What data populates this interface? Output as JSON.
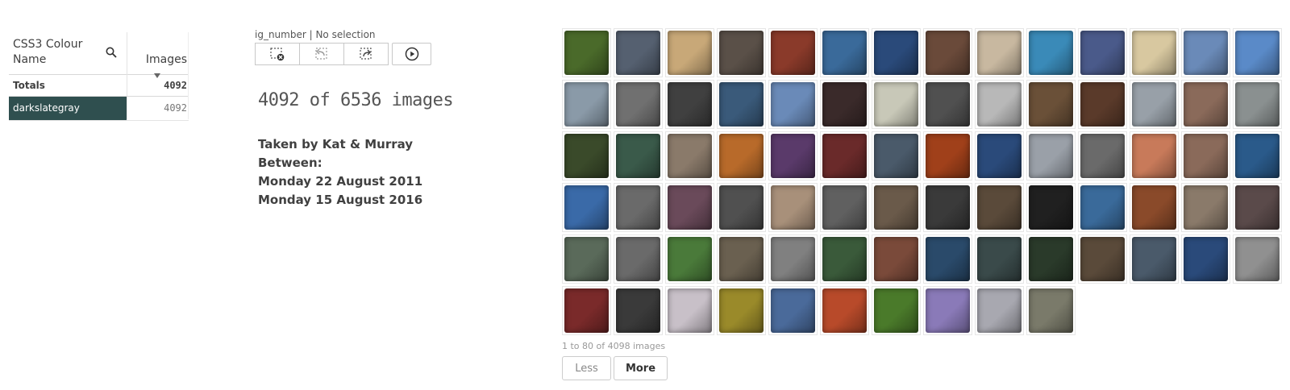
{
  "table": {
    "col1_header": "CSS3 Colour Name",
    "col2_header": "Images",
    "totals_label": "Totals",
    "totals_value": "4092",
    "rows": [
      {
        "label": "darkslategray",
        "value": "4092",
        "color": "#2f4f4f"
      }
    ],
    "search_icon": "search-icon",
    "sort_indicator_icon": "sort-descending-icon"
  },
  "selection": {
    "field_label": "ig_number | No selection",
    "buttons": [
      {
        "name": "clear-selection",
        "icon": "clear-selection-icon"
      },
      {
        "name": "step-back",
        "icon": "undo-selection-icon"
      },
      {
        "name": "step-forward",
        "icon": "redo-selection-icon"
      },
      {
        "name": "play",
        "icon": "play-icon"
      }
    ]
  },
  "kpi": {
    "text": "4092 of 6536 images"
  },
  "info": {
    "line1": "Taken by Kat & Murray",
    "line2": "Between:",
    "line3": "Monday 22 August 2011",
    "line4": "Monday 15 August 2016"
  },
  "gallery": {
    "columns": 14,
    "visible_count": 80,
    "thumbnail_colors": [
      "#4a6a2a",
      "#556070",
      "#c8a878",
      "#5a5048",
      "#8a3a2a",
      "#3a6a9a",
      "#2a4a7a",
      "#6a4a3a",
      "#c8b8a0",
      "#3a8ab8",
      "#4a5a8a",
      "#d8c8a0",
      "#6a8ab8",
      "#5a8ac8",
      "#8a9aa8",
      "#707070",
      "#404040",
      "#3a5a7a",
      "#6a8ab8",
      "#3a2a2a",
      "#c8c8b8",
      "#505050",
      "#b8b8b8",
      "#6a5038",
      "#5a3a2a",
      "#98a0a8",
      "#8a6a5a",
      "#8a9090",
      "#3a4a2a",
      "#3a5a4a",
      "#8a7a6a",
      "#b86a2a",
      "#5a3a6a",
      "#6a2a2a",
      "#4a5a6a",
      "#a0401a",
      "#2a4a7a",
      "#9aa0a8",
      "#6a6a6a",
      "#c87a5a",
      "#8a6a5a",
      "#2a5a8a",
      "#3a6aa8",
      "#6a6a6a",
      "#6a4a5a",
      "#505050",
      "#a8907a",
      "#606060",
      "#6a5a4a",
      "#3a3a3a",
      "#5a4a3a",
      "#202020",
      "#3a6a9a",
      "#8a4a2a",
      "#8a7a6a",
      "#5a4a4a",
      "#5a6a5a",
      "#6a6a6a",
      "#4a7a3a",
      "#6a6050",
      "#808080",
      "#3a5a3a",
      "#7a4a3a",
      "#2a4a6a",
      "#3a4a4a",
      "#2a3a2a",
      "#5a4a3a",
      "#4a5a6a",
      "#2a4a7a",
      "#909090",
      "#7a2a2a",
      "#3a3a3a",
      "#c8c0c8",
      "#9a8a2a",
      "#4a6a9a",
      "#b84a2a",
      "#4a7a2a",
      "#8a7ab8",
      "#a8a8b0",
      "#7a7a6a"
    ],
    "range_text": "1 to 80 of 4098 images",
    "less_label": "Less",
    "more_label": "More"
  }
}
